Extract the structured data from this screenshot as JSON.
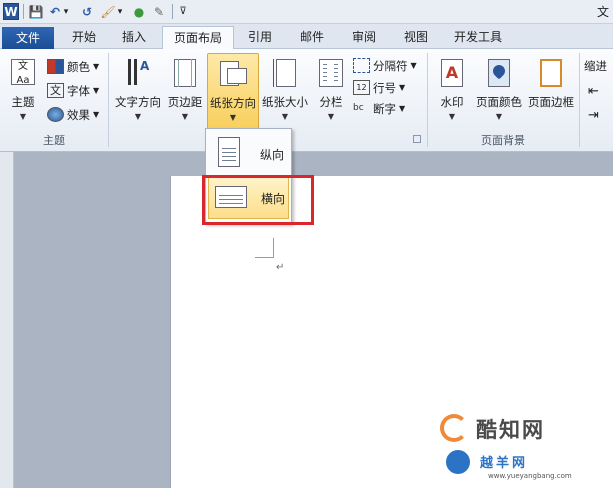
{
  "qat": {
    "logo": "W",
    "save": "💾",
    "undo": "↶",
    "undo_dd": "▾",
    "redo": "↺",
    "format_painter": "🖌",
    "format_dd": "▾",
    "color_wheel": "●",
    "eraser": "✎",
    "customize": "⊽",
    "title_fragment": "文"
  },
  "tabs": [
    "文件",
    "开始",
    "插入",
    "页面布局",
    "引用",
    "邮件",
    "审阅",
    "视图",
    "开发工具"
  ],
  "ribbon": {
    "theme_group": {
      "label": "主题",
      "theme_button": "主题",
      "colors": "颜色",
      "fonts": "字体",
      "effects": "效果"
    },
    "page_setup": {
      "text_direction": "文字方向",
      "margins": "页边距",
      "orientation": "纸张方向",
      "size": "纸张大小",
      "columns": "分栏",
      "breaks": "分隔符",
      "line_numbers": "行号",
      "hyphenation": "断字"
    },
    "page_background": {
      "label": "页面背景",
      "watermark": "水印",
      "page_color": "页面颜色",
      "page_borders": "页面边框"
    },
    "indent": {
      "label": "缩进"
    }
  },
  "orientation_menu": {
    "portrait": "纵向",
    "landscape": "横向"
  },
  "document": {
    "paragraph_mark": "↵"
  },
  "watermark": {
    "site_name": "酷知网",
    "site_name2": "越羊网",
    "url": "www.yueyangbang.com"
  },
  "colors": {
    "accent_blue": "#2a5699",
    "highlight": "#f8cf5c",
    "red_box": "#d8272d"
  }
}
